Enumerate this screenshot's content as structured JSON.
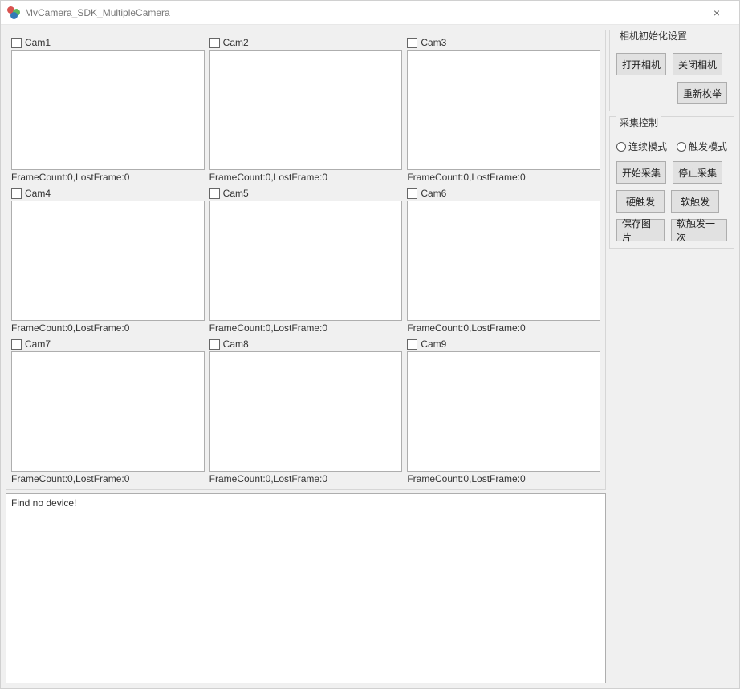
{
  "window": {
    "title": "MvCamera_SDK_MultipleCamera",
    "close_icon": "×"
  },
  "cameras": [
    {
      "label": "Cam1",
      "status": "FrameCount:0,LostFrame:0"
    },
    {
      "label": "Cam2",
      "status": "FrameCount:0,LostFrame:0"
    },
    {
      "label": "Cam3",
      "status": "FrameCount:0,LostFrame:0"
    },
    {
      "label": "Cam4",
      "status": "FrameCount:0,LostFrame:0"
    },
    {
      "label": "Cam5",
      "status": "FrameCount:0,LostFrame:0"
    },
    {
      "label": "Cam6",
      "status": "FrameCount:0,LostFrame:0"
    },
    {
      "label": "Cam7",
      "status": "FrameCount:0,LostFrame:0"
    },
    {
      "label": "Cam8",
      "status": "FrameCount:0,LostFrame:0"
    },
    {
      "label": "Cam9",
      "status": "FrameCount:0,LostFrame:0"
    }
  ],
  "log": {
    "text": "Find no device!"
  },
  "init": {
    "title": "相机初始化设置",
    "open": "打开相机",
    "close": "关闭相机",
    "reenum": "重新枚举"
  },
  "capture": {
    "title": "采集控制",
    "mode_continuous": "连续模式",
    "mode_trigger": "触发模式",
    "start": "开始采集",
    "stop": "停止采集",
    "hard_trigger": "硬触发",
    "soft_trigger": "软触发",
    "save_image": "保存图片",
    "soft_trigger_once": "软触发一次"
  }
}
